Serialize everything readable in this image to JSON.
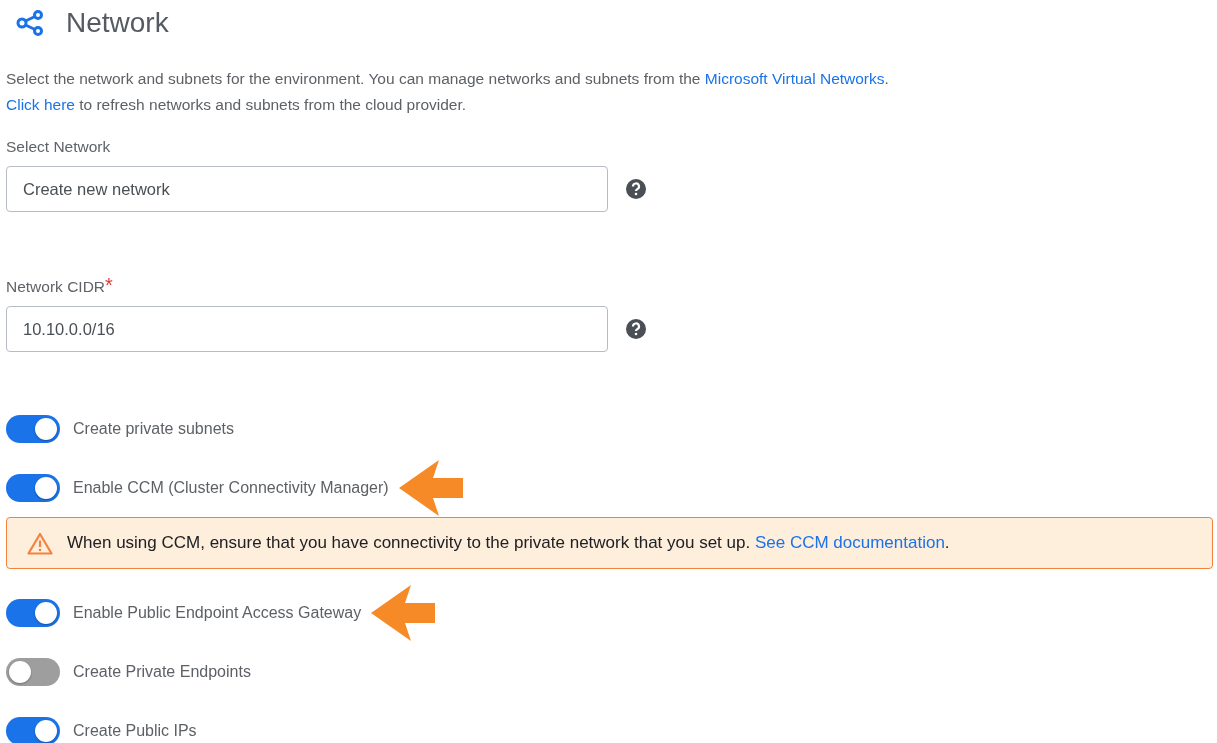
{
  "header": {
    "title": "Network"
  },
  "description": {
    "line_1": "Select the network and subnets for the environment. You can manage networks and subnets from the ",
    "line_1_link": "Microsoft Virtual Networks",
    "line_1_end": ".",
    "line_2_link": "Click here",
    "line_2": " to refresh networks and subnets from the cloud provider."
  },
  "fields": [
    {
      "label": "Select Network",
      "value": "Create new network"
    },
    {
      "label": "Network CIDR",
      "value": "10.10.0.0/16",
      "required_mark": "*"
    }
  ],
  "toggles": [
    {
      "kind": "toggle",
      "label": "Create private subnets",
      "on": true,
      "annotated": false
    },
    {
      "kind": "toggle",
      "label": "Enable CCM (Cluster Connectivity Manager)",
      "on": true,
      "annotated": true
    },
    {
      "kind": "alert",
      "text": "When using CCM, ensure that you have connectivity to the private network that you set up. ",
      "link": "See CCM documentation",
      "end": "."
    },
    {
      "kind": "toggle",
      "label": "Enable Public Endpoint Access Gateway",
      "on": true,
      "annotated": true
    },
    {
      "kind": "toggle",
      "label": "Create Private Endpoints",
      "on": false,
      "annotated": false
    },
    {
      "kind": "toggle",
      "label": "Create Public IPs",
      "on": true,
      "annotated": false
    }
  ]
}
